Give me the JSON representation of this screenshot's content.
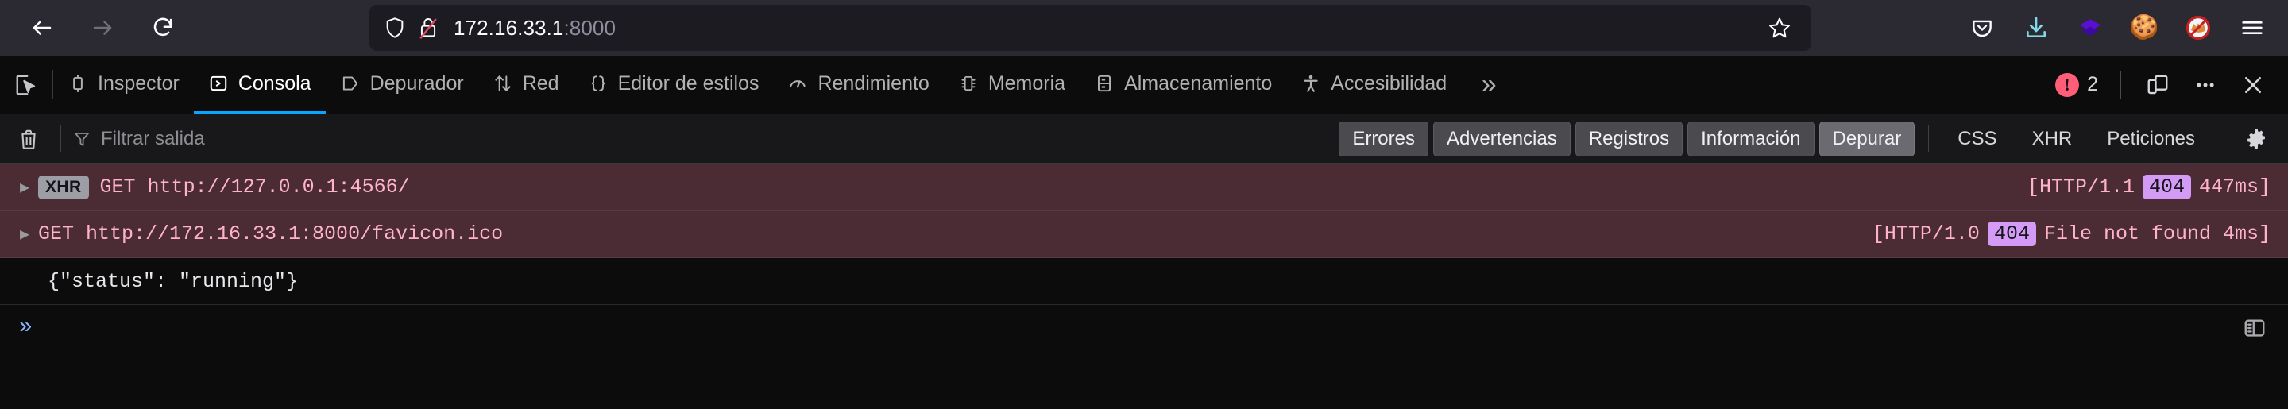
{
  "browser": {
    "nav": {
      "back_label": "Atrás",
      "forward_label": "Adelante",
      "reload_label": "Recargar"
    },
    "urlbar": {
      "host": "172.16.33.1",
      "port": ":8000",
      "shield_icon": "shield-icon",
      "lock_icon": "lock-insecure-icon",
      "star_icon": "bookmark-star-icon"
    },
    "toolbar_icons": [
      {
        "name": "pocket-icon",
        "glyph": ""
      },
      {
        "name": "downloads-icon",
        "glyph": ""
      },
      {
        "name": "extension-layers-icon",
        "glyph": ""
      },
      {
        "name": "cookie-icon",
        "glyph": "🍪"
      },
      {
        "name": "no-fox-icon",
        "glyph": ""
      },
      {
        "name": "app-menu-icon",
        "glyph": ""
      }
    ]
  },
  "devtools": {
    "picker_icon": "element-picker-icon",
    "tabs": [
      {
        "label": "Inspector",
        "icon": "inspector-icon",
        "active": false
      },
      {
        "label": "Consola",
        "icon": "console-icon",
        "active": true
      },
      {
        "label": "Depurador",
        "icon": "debugger-icon",
        "active": false
      },
      {
        "label": "Red",
        "icon": "network-icon",
        "active": false
      },
      {
        "label": "Editor de estilos",
        "icon": "style-editor-icon",
        "active": false
      },
      {
        "label": "Rendimiento",
        "icon": "performance-icon",
        "active": false
      },
      {
        "label": "Memoria",
        "icon": "memory-icon",
        "active": false
      },
      {
        "label": "Almacenamiento",
        "icon": "storage-icon",
        "active": false
      },
      {
        "label": "Accesibilidad",
        "icon": "accessibility-icon",
        "active": false
      }
    ],
    "overflow_label": "»",
    "error_count": "2",
    "error_badge_color": "#ff5d78",
    "accent_color": "#0aa5ff",
    "right_icons": [
      {
        "name": "responsive-design-mode-icon"
      },
      {
        "name": "meatball-menu-icon"
      },
      {
        "name": "close-devtools-icon"
      }
    ],
    "filterbar": {
      "clear_icon": "trash-icon",
      "filter_icon": "funnel-icon",
      "filter_placeholder": "Filtrar salida",
      "filter_value": "",
      "buttons": [
        {
          "label": "Errores",
          "pressed": false
        },
        {
          "label": "Advertencias",
          "pressed": false
        },
        {
          "label": "Registros",
          "pressed": false
        },
        {
          "label": "Información",
          "pressed": false
        },
        {
          "label": "Depurar",
          "pressed": true
        }
      ],
      "plain_buttons": [
        {
          "label": "CSS"
        },
        {
          "label": "XHR"
        },
        {
          "label": "Peticiones"
        }
      ],
      "settings_icon": "gear-icon"
    },
    "console_rows": [
      {
        "type": "error",
        "twisty": "▶",
        "badge": "XHR",
        "message": "GET http://127.0.0.1:4566/",
        "meta_prefix": "[HTTP/1.1",
        "status": "404",
        "meta_suffix": "447ms]",
        "status_color": "#d39bf5"
      },
      {
        "type": "error",
        "twisty": "▶",
        "badge": "",
        "message": "GET http://172.16.33.1:8000/favicon.ico",
        "meta_prefix": "[HTTP/1.0",
        "status": "404",
        "meta_suffix": "File not found 4ms]",
        "status_color": "#d39bf5"
      },
      {
        "type": "log",
        "twisty": "",
        "badge": "",
        "message": "{\"status\": \"running\"}",
        "meta_prefix": "",
        "status": "",
        "meta_suffix": ""
      }
    ],
    "prompt": {
      "chevron": "»",
      "value": "",
      "placeholder": "",
      "split_icon": "split-console-icon"
    }
  }
}
